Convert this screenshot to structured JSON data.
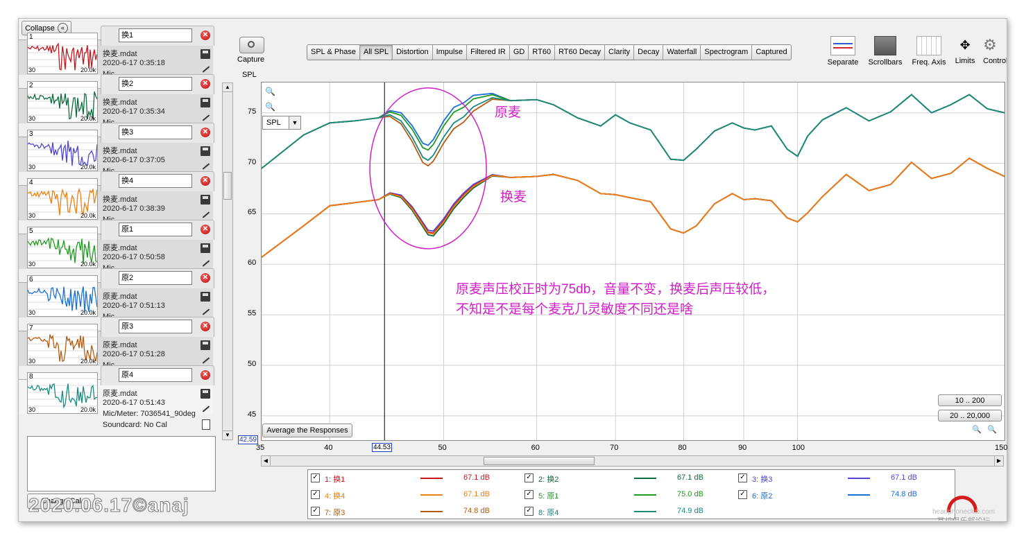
{
  "window": {
    "collapse_label": "Collapse",
    "capture_label": "Capture",
    "change_cal_label": "Change Cal"
  },
  "measurements": [
    {
      "num": "1",
      "name": "换1",
      "file": "换麦.mdat",
      "date": "2020-6-17 0:35:18",
      "mic": "Mic",
      "color": "#c8161d",
      "selected": false
    },
    {
      "num": "2",
      "name": "换2",
      "file": "换麦.mdat",
      "date": "2020-6-17 0:35:34",
      "mic": "Mic",
      "color": "#0e6b3b",
      "selected": false
    },
    {
      "num": "3",
      "name": "换3",
      "file": "换麦.mdat",
      "date": "2020-6-17 0:37:05",
      "mic": "Mic",
      "color": "#4f45d6",
      "selected": false
    },
    {
      "num": "4",
      "name": "换4",
      "file": "换麦.mdat",
      "date": "2020-6-17 0:38:39",
      "mic": "Mic",
      "color": "#ef7f12",
      "selected": false
    },
    {
      "num": "5",
      "name": "原1",
      "file": "原麦.mdat",
      "date": "2020-6-17 0:50:58",
      "mic": "Mic",
      "color": "#1f9b1f",
      "selected": false
    },
    {
      "num": "6",
      "name": "原2",
      "file": "原麦.mdat",
      "date": "2020-6-17 0:51:13",
      "mic": "Mic",
      "color": "#1a6fd6",
      "selected": false
    },
    {
      "num": "7",
      "name": "原3",
      "file": "原麦.mdat",
      "date": "2020-6-17 0:51:28",
      "mic": "Mic",
      "color": "#b55b10",
      "selected": false
    },
    {
      "num": "8",
      "name": "原4",
      "file": "原麦.mdat",
      "date": "2020-6-17 0:51:43",
      "mic": "Mic/Meter: 7036541_90deg",
      "soundcard": "Soundcard: No Cal",
      "color": "#178b7f",
      "selected": true
    }
  ],
  "thumb_axis": {
    "left": "30",
    "right": "20.0k"
  },
  "tabs": [
    "SPL & Phase",
    "All SPL",
    "Distortion",
    "Impulse",
    "Filtered IR",
    "GD",
    "RT60",
    "RT60 Decay",
    "Clarity",
    "Decay",
    "Waterfall",
    "Spectrogram",
    "Captured"
  ],
  "active_tab": "All SPL",
  "right_tools": [
    "Separate",
    "Scrollbars",
    "Freq. Axis",
    "Limits",
    "Controls"
  ],
  "plot": {
    "y_axis_title": "SPL",
    "y_ticks": [
      "75",
      "70",
      "65",
      "60",
      "55",
      "50",
      "45"
    ],
    "x_ticks": [
      "35",
      "40",
      "50",
      "60",
      "70",
      "80",
      "90",
      "100",
      "150"
    ],
    "x_marker_label": "44.53",
    "y_cursor_label": "42.59",
    "spl_select": "SPL",
    "average_button": "Average the Responses",
    "range_buttons": [
      "10 .. 200",
      "20 .. 20,000"
    ],
    "annotation_yuanmai": "原麦",
    "annotation_huanmai": "换麦",
    "note_line1": "原麦声压校正时为75db，音量不变，换麦后声压较低，",
    "note_line2": "不知是不是每个麦克几灵敏度不同还是啥",
    "annotation_color": "#d21ec8"
  },
  "legend": [
    {
      "label": "1: 换1",
      "value": "67.1 dB",
      "color": "#c8161d"
    },
    {
      "label": "2: 换2",
      "value": "67.1 dB",
      "color": "#0e6b3b"
    },
    {
      "label": "3: 换3",
      "value": "67.1 dB",
      "color": "#4f45d6"
    },
    {
      "label": "4: 换4",
      "value": "67.1 dB",
      "color": "#ef7f12"
    },
    {
      "label": "5: 原1",
      "value": "75.0 dB",
      "color": "#1f9b1f"
    },
    {
      "label": "6: 原2",
      "value": "74.8 dB",
      "color": "#1a6fd6"
    },
    {
      "label": "7: 原3",
      "value": "74.8 dB",
      "color": "#b55b10"
    },
    {
      "label": "8: 原4",
      "value": "74.9 dB",
      "color": "#178b7f"
    }
  ],
  "watermark": "2020.06.17©anaj",
  "logo_text": "headphoneclub.com",
  "logo_subtext": "耳机俱乐部论坛",
  "chart_data": {
    "type": "line",
    "xlabel": "",
    "ylabel": "SPL",
    "xlim": [
      35,
      150
    ],
    "x_scale": "log",
    "ylim": [
      42.59,
      78
    ],
    "grid": true,
    "x": [
      35,
      38,
      40,
      42,
      44,
      45,
      46,
      47,
      48,
      48.5,
      49,
      50,
      51,
      52,
      53,
      55,
      57,
      60,
      62,
      65,
      68,
      70,
      72,
      75,
      78,
      80,
      82,
      85,
      88,
      90,
      92,
      95,
      98,
      100,
      102,
      105,
      110,
      115,
      120,
      125,
      130,
      135,
      140,
      145,
      150
    ],
    "series": [
      {
        "name": "原麦",
        "values": [
          69.5,
          72.8,
          74.0,
          74.2,
          74.5,
          74.8,
          74.2,
          72.6,
          70.6,
          70.3,
          70.8,
          72.6,
          74.0,
          74.6,
          75.6,
          76.5,
          76.2,
          76.3,
          75.8,
          74.5,
          73.7,
          74.8,
          74.0,
          73.3,
          70.4,
          70.3,
          71.4,
          73.2,
          74.0,
          73.5,
          73.3,
          73.7,
          71.4,
          70.7,
          72.7,
          74.3,
          75.5,
          74.2,
          75.1,
          76.8,
          75.0,
          75.8,
          76.8,
          75.4,
          75.0
        ]
      },
      {
        "name": "换麦",
        "values": [
          60.7,
          63.8,
          65.8,
          66.1,
          66.4,
          67.0,
          66.7,
          65.5,
          63.9,
          63.1,
          63.0,
          64.2,
          65.7,
          66.8,
          67.7,
          68.8,
          68.6,
          68.7,
          68.9,
          68.3,
          67.0,
          66.9,
          66.6,
          66.2,
          63.5,
          63.1,
          63.8,
          66.0,
          67.0,
          66.4,
          66.5,
          66.3,
          64.6,
          64.2,
          65.1,
          66.7,
          68.9,
          67.3,
          67.9,
          70.1,
          68.5,
          69.0,
          70.5,
          69.5,
          68.7
        ]
      }
    ]
  }
}
